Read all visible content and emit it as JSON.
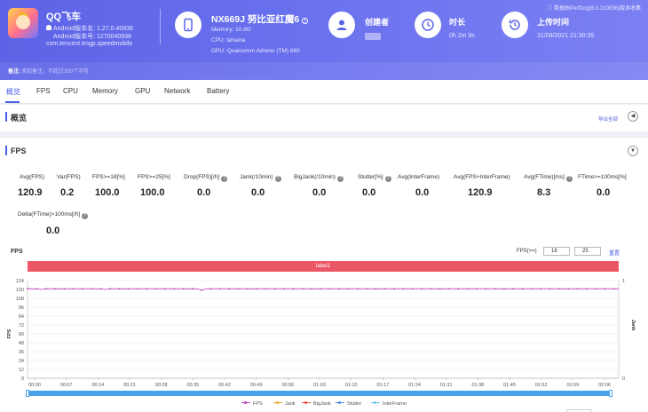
{
  "header": {
    "app_name": "QQ飞车",
    "android_version": "Android版本名: 1.27.0.40938",
    "android_code": "Android版本号: 1270040938",
    "package": "com.tencent.tmgp.speedmobile",
    "device_name": "NX669J 努比亚红魔6",
    "memory": "Memory: 10.9G",
    "cpu": "CPU: lahaina",
    "gpu": "GPU: Qualcomm Adreno (TM) 660",
    "creator_label": "创建者",
    "duration_label": "时长",
    "duration_value": "0h 2m 9s",
    "upload_label": "上传时间",
    "upload_value": "31/08/2021 21:30:35",
    "version_note": "数据由PerfDog(6.0.210836)版本收集",
    "note_label": "备注:",
    "note_placeholder": "添加备注，不超过200个字符"
  },
  "tabs": [
    "概览",
    "FPS",
    "CPU",
    "Memory",
    "GPU",
    "Network",
    "Battery"
  ],
  "overview": {
    "title": "概览",
    "export": "导出全部"
  },
  "fps_section": {
    "title": "FPS",
    "metrics": [
      {
        "label": "Avg(FPS)",
        "value": "120.9",
        "help": false
      },
      {
        "label": "Var(FPS)",
        "value": "0.2",
        "help": false
      },
      {
        "label": "FPS>=18[%]",
        "value": "100.0",
        "help": false
      },
      {
        "label": "FPS>=25[%]",
        "value": "100.0",
        "help": false
      },
      {
        "label": "Drop(FPS)[/h]",
        "value": "0.0",
        "help": true
      },
      {
        "label": "Jank(/10min)",
        "value": "0.0",
        "help": true
      },
      {
        "label": "BigJank(/10min)",
        "value": "0.0",
        "help": true
      },
      {
        "label": "Stutter[%]",
        "value": "0.0",
        "help": true
      },
      {
        "label": "Avg(InterFrame)",
        "value": "0.0",
        "help": false
      },
      {
        "label": "Avg(FPS+InterFrame)",
        "value": "120.9",
        "help": false
      },
      {
        "label": "Avg(FTime)[ms]",
        "value": "8.3",
        "help": true
      },
      {
        "label": "FTime>=100ms[%]",
        "value": "0.0",
        "help": false
      },
      {
        "label": "Delta(FTime)>100ms[/h]",
        "value": "0.0",
        "help": true
      }
    ]
  },
  "chart_controls": {
    "title": "FPS",
    "filter_label": "FPS(>=)",
    "filter_min": "18",
    "filter_max": "25",
    "reset": "重置",
    "band_label": "label1"
  },
  "chart_data": {
    "type": "line",
    "ylabel": "FPS",
    "y2label": "Jank",
    "ylim": [
      0,
      132
    ],
    "y2lim": [
      0,
      1
    ],
    "yticks": [
      0,
      12,
      24,
      36,
      48,
      60,
      72,
      84,
      96,
      108,
      120,
      132
    ],
    "ytick_labels": [
      "0",
      "12",
      "24",
      "36",
      "48",
      "60",
      "72",
      "84",
      "96",
      "108",
      "120",
      "124"
    ],
    "y2ticks": [
      0,
      1
    ],
    "xticks": [
      "00:00",
      "00:07",
      "00:14",
      "00:21",
      "00:28",
      "00:35",
      "00:42",
      "00:49",
      "00:56",
      "01:03",
      "01:10",
      "01:17",
      "01:24",
      "01:31",
      "01:38",
      "01:45",
      "01:52",
      "01:59",
      "02:06"
    ],
    "duration_s": 129,
    "grid": true,
    "legend_position": "bottom",
    "series": [
      {
        "name": "FPS",
        "color": "#c23fc5",
        "y": [
          121,
          121,
          121,
          120,
          121,
          121,
          121,
          121,
          121,
          121,
          121,
          121,
          121,
          121,
          121,
          121,
          121,
          120,
          121,
          121,
          121,
          121,
          121,
          121,
          121,
          121,
          121,
          121,
          121,
          121,
          121,
          121,
          121,
          121,
          121,
          121,
          121,
          121,
          119,
          121,
          121,
          121,
          121,
          121,
          121,
          121,
          121,
          121,
          121,
          121,
          121,
          121,
          121,
          121,
          121,
          121,
          121,
          121,
          121,
          121,
          121,
          121,
          121,
          121,
          121,
          121,
          121,
          121,
          121,
          121,
          121,
          121,
          121,
          121,
          121,
          121,
          121,
          121,
          121,
          121,
          121,
          121,
          121,
          121,
          121,
          121,
          121,
          121,
          121,
          121,
          121,
          121,
          121,
          121,
          121,
          121,
          121,
          121,
          121,
          121,
          121,
          121,
          121,
          121,
          121,
          121,
          121,
          121,
          121,
          121,
          121,
          121,
          121,
          121,
          121,
          121,
          121,
          121,
          121,
          121,
          121,
          121,
          121,
          121,
          121,
          121,
          121,
          121,
          121,
          121
        ]
      },
      {
        "name": "Jank",
        "color": "#f5a623",
        "y": []
      },
      {
        "name": "BigJank",
        "color": "#e8493a",
        "y": []
      },
      {
        "name": "Stutter",
        "color": "#4a90e2",
        "y": []
      },
      {
        "name": "InterFrame",
        "color": "#6cc7e8",
        "y": []
      }
    ]
  },
  "colors": {
    "accent": "#4a5fe6",
    "band": "#ec5766",
    "slider": "#4aa3ea"
  }
}
